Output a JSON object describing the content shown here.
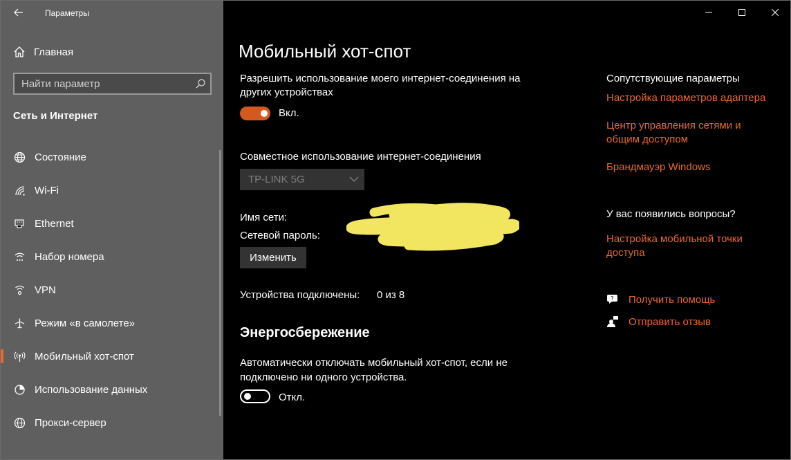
{
  "app": {
    "title": "Параметры"
  },
  "sidebar": {
    "home_label": "Главная",
    "search_placeholder": "Найти параметр",
    "section_title": "Сеть и Интернет",
    "items": [
      {
        "label": "Состояние",
        "icon": "globe-icon"
      },
      {
        "label": "Wi-Fi",
        "icon": "wifi-icon"
      },
      {
        "label": "Ethernet",
        "icon": "ethernet-icon"
      },
      {
        "label": "Набор номера",
        "icon": "dialup-icon"
      },
      {
        "label": "VPN",
        "icon": "vpn-icon"
      },
      {
        "label": "Режим «в самолете»",
        "icon": "airplane-icon"
      },
      {
        "label": "Мобильный хот-спот",
        "icon": "hotspot-icon",
        "active": true
      },
      {
        "label": "Использование данных",
        "icon": "data-usage-icon"
      },
      {
        "label": "Прокси-сервер",
        "icon": "proxy-globe-icon"
      }
    ]
  },
  "main": {
    "title": "Мобильный хот-спот",
    "share_label": "Разрешить использование моего интернет-соединения на других устройствах",
    "share_toggle_text": "Вкл.",
    "connection_label": "Совместное использование интернет-соединения",
    "connection_value": "TP-LINK 5G",
    "network_name_label": "Имя сети:",
    "network_password_label": "Сетевой пароль:",
    "edit_button": "Изменить",
    "devices_label": "Устройства подключены:",
    "devices_value": "0 из 8",
    "power_title": "Энергосбережение",
    "power_desc": "Автоматически отключать мобильный хот-спот, если не подключено ни одного устройства.",
    "power_toggle_text": "Откл."
  },
  "related": {
    "heading": "Сопутствующие параметры",
    "links": [
      "Настройка параметров адаптера",
      "Центр управления сетями и общим доступом",
      "Брандмауэр Windows"
    ],
    "questions_heading": "У вас появились вопросы?",
    "questions_link": "Настройка мобильной точки доступа",
    "help_link": "Получить помощь",
    "feedback_link": "Отправить отзыв"
  },
  "colors": {
    "accent": "#e8692e",
    "toggle_on": "#d4591f",
    "sidebar_bg": "#5f5f5f",
    "main_bg": "#000000",
    "redaction": "#f2e55f"
  }
}
